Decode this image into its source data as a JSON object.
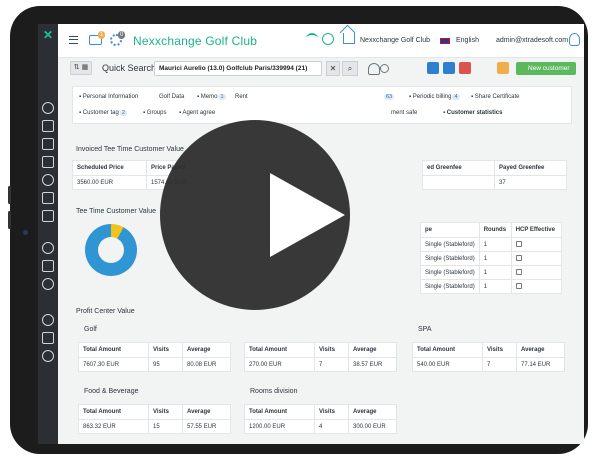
{
  "app": {
    "title": "Nexxchange Golf Club",
    "club": "Nexxchange Golf Club",
    "language": "English",
    "user": "admin@xtradesoft.com",
    "mail_badge": "1",
    "settings_badge": "0"
  },
  "search": {
    "label": "Quick Search",
    "value": "Maurici Aurelio (13.0) Golfclub Paris/339994 (21)",
    "clear": "✕",
    "search_icon": "⌕",
    "view_toggle": "⇅ ▦"
  },
  "actions": {
    "new_customer": "New customer"
  },
  "tabs": {
    "row1": [
      {
        "label": "Personal Information",
        "badge": ""
      },
      {
        "label": "Golf Data",
        "badge": ""
      },
      {
        "label": "Memo",
        "badge": "1"
      },
      {
        "label": "Rent",
        "badge": ""
      },
      {
        "label": "",
        "badge": "63"
      },
      {
        "label": "Periodic billing",
        "badge": "4"
      },
      {
        "label": "Share Certificate",
        "badge": ""
      }
    ],
    "row2": [
      {
        "label": "Customer tag",
        "badge": "2"
      },
      {
        "label": "Groups",
        "badge": ""
      },
      {
        "label": "Agent agree",
        "badge": ""
      },
      {
        "label": "ment safe",
        "badge": ""
      },
      {
        "label": "Customer statistics",
        "badge": ""
      }
    ]
  },
  "invoiced": {
    "title": "Invoiced Tee Time Customer Value",
    "headers_left": [
      "Scheduled Price",
      "Price Payed"
    ],
    "values_left": [
      "3560.00 EUR",
      "1574.00 EUR"
    ],
    "headers_right": [
      "ed Greenfee",
      "Payed Greenfee"
    ],
    "values_right": [
      "",
      "37"
    ]
  },
  "tee_time": {
    "title": "Tee Time Customer Value",
    "headers": [
      "pe",
      "Rounds",
      "HCP Effective"
    ],
    "rows": [
      [
        "Single (Stableford)",
        "1"
      ],
      [
        "Single (Stableford)",
        "1"
      ],
      [
        "Single (Stableford)",
        "1"
      ],
      [
        "Single (Stableford)",
        "1"
      ]
    ]
  },
  "profit": {
    "title": "Profit Center Value",
    "headers": [
      "Total Amount",
      "Visits",
      "Average"
    ],
    "centers": [
      {
        "name": "Golf",
        "total": "7607.30 EUR",
        "visits": "95",
        "average": "80.08 EUR"
      },
      {
        "name": "",
        "total": "270.00 EUR",
        "visits": "7",
        "average": "38.57 EUR"
      },
      {
        "name": "SPA",
        "total": "540.00 EUR",
        "visits": "7",
        "average": "77.14 EUR"
      },
      {
        "name": "Food & Beverage",
        "total": "863.32 EUR",
        "visits": "15",
        "average": "57.55 EUR"
      },
      {
        "name": "Rooms division",
        "total": "1200.00 EUR",
        "visits": "4",
        "average": "300.00 EUR"
      }
    ]
  },
  "chart_data": {
    "type": "pie",
    "categories": [
      "",
      ""
    ],
    "values": [
      8,
      92
    ],
    "colors": [
      "#f0c419",
      "#2f96d3"
    ]
  },
  "colors": {
    "accent": "#19b48c",
    "blue": "#3c8fd8",
    "green_button": "#5cb85c"
  },
  "icons": [
    "menu-icon",
    "mail-icon",
    "gear-icon",
    "wifi-icon",
    "globe-icon",
    "home-icon",
    "flag-icon",
    "user-icon",
    "play-icon"
  ]
}
